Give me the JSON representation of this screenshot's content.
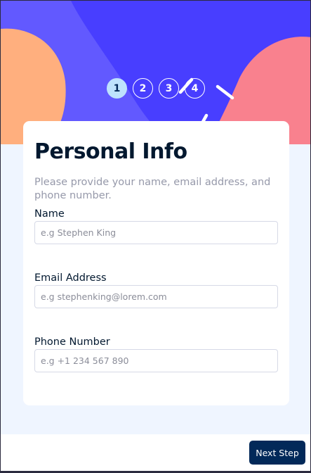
{
  "steps": [
    "1",
    "2",
    "3",
    "4"
  ],
  "active_step": 1,
  "page": {
    "title": "Personal Info",
    "subtitle": "Please provide your name, email address, and phone number."
  },
  "fields": {
    "name": {
      "label": "Name",
      "placeholder": "e.g Stephen King"
    },
    "email": {
      "label": "Email Address",
      "placeholder": "e.g stephenking@lorem.com"
    },
    "phone": {
      "label": "Phone Number",
      "placeholder": "e.g +1 234 567 890"
    }
  },
  "footer": {
    "next_label": "Next Step"
  },
  "colors": {
    "hero_bg": "#483eff",
    "hero_wave": "#6259ff",
    "orange_blob": "#ffaf7e",
    "pink_blob": "#f9818e",
    "active_step_bg": "#bee2fd",
    "button_bg": "#022959",
    "page_bg": "#eff5ff"
  }
}
